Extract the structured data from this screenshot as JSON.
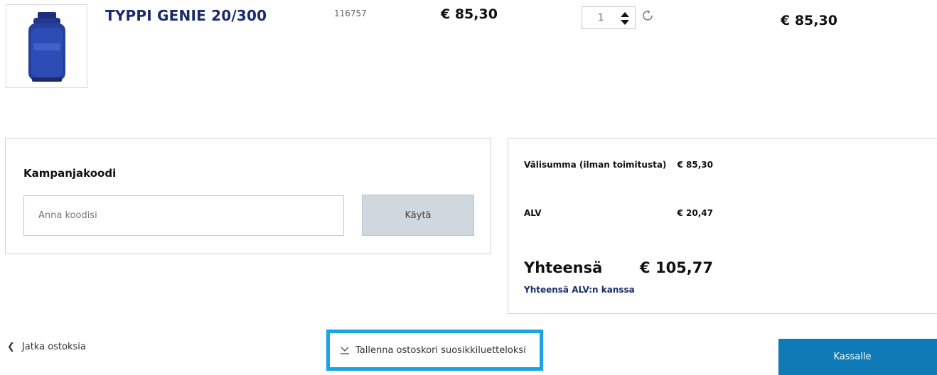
{
  "product": {
    "name": "TYPPI GENIE 20/300",
    "sku": "116757",
    "unit_price": "€ 85,30",
    "quantity": "1",
    "line_total": "€ 85,30"
  },
  "promo": {
    "title": "Kampanjakoodi",
    "placeholder": "Anna koodisi",
    "apply_label": "Käytä"
  },
  "summary": {
    "subtotal_label": "Välisumma (ilman toimitusta)",
    "subtotal_value": "€ 85,30",
    "vat_label": "ALV",
    "vat_value": "€ 20,47",
    "total_label": "Yhteensä",
    "total_value": "€ 105,77",
    "total_sub": "Yhteensä ALV:n kanssa"
  },
  "actions": {
    "back_icon": "chevron-left-icon",
    "back_label": "Jatka ostoksia",
    "save_icon": "download-icon",
    "save_label": "Tallenna ostoskori suosikkiluetteloksi",
    "checkout_label": "Kassalle"
  },
  "colors": {
    "brand_navy": "#1a2b6b",
    "highlight": "#19a4e3",
    "checkout": "#0f7bb6"
  }
}
